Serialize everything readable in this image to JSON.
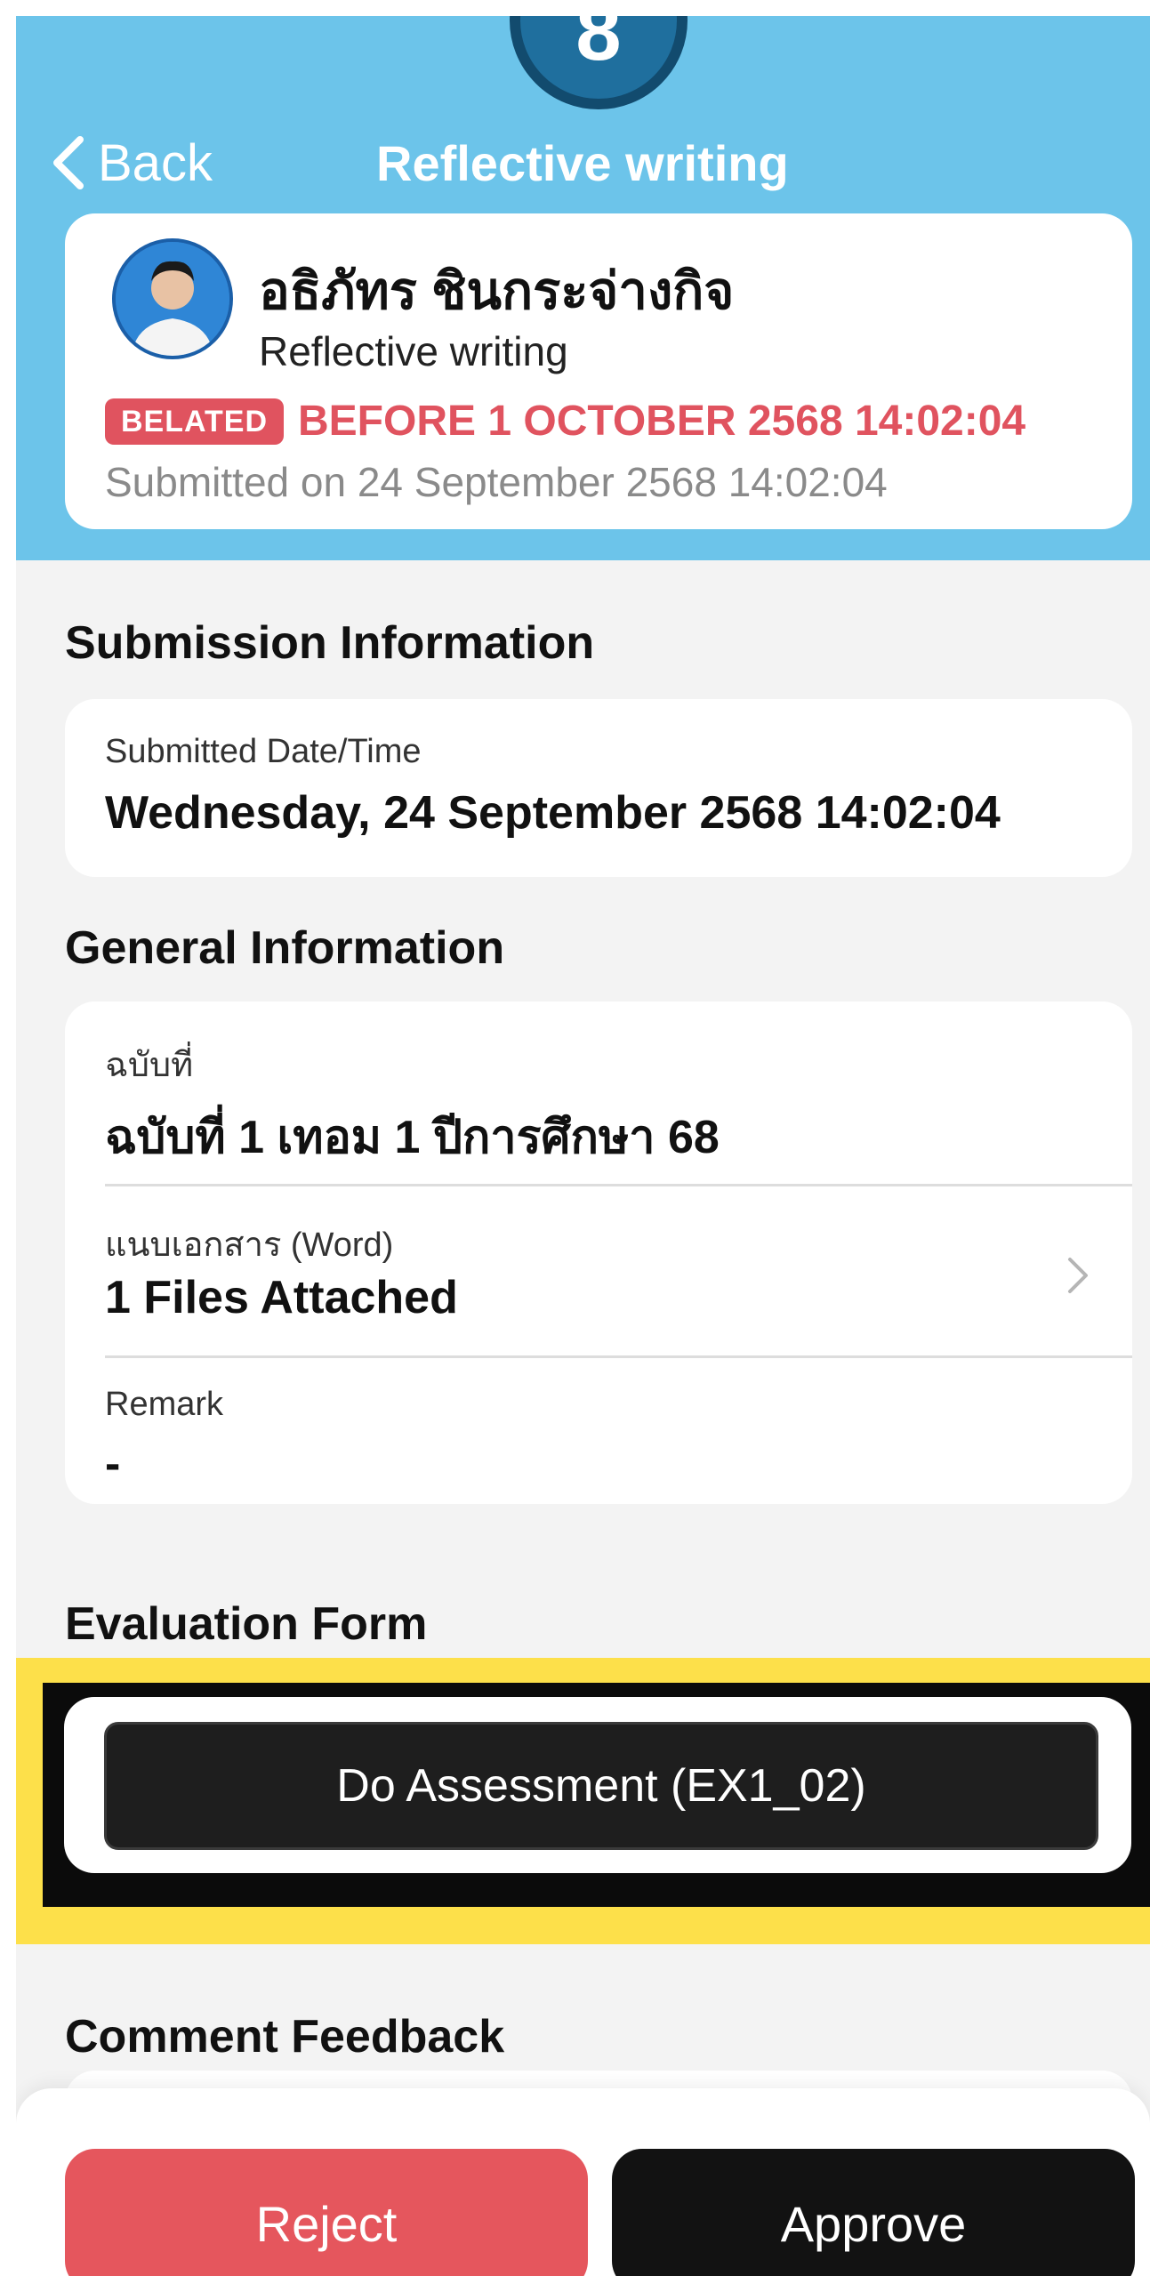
{
  "step": "8",
  "nav": {
    "back_label": "Back",
    "title": "Reflective writing"
  },
  "profile": {
    "name": "อธิภัทร ชินกระจ่างกิจ",
    "assignment": "Reflective writing",
    "status_badge": "BELATED",
    "due": "BEFORE 1 OCTOBER 2568 14:02:04",
    "submitted": "Submitted on 24 September 2568 14:02:04"
  },
  "submission_info": {
    "section_title": "Submission Information",
    "label": "Submitted Date/Time",
    "value": "Wednesday, 24 September 2568 14:02:04"
  },
  "general_info": {
    "section_title": "General Information",
    "fields": [
      {
        "label": "ฉบับที่",
        "value": "ฉบับที่ 1 เทอม 1 ปีการศึกษา 68"
      },
      {
        "label": "แนบเอกสาร (Word)",
        "value": "1 Files Attached"
      },
      {
        "label": "Remark",
        "value": "-"
      }
    ]
  },
  "evaluation": {
    "section_title": "Evaluation Form",
    "button_label": "Do Assessment (EX1_02)"
  },
  "comment": {
    "section_title": "Comment Feedback"
  },
  "actions": {
    "reject_label": "Reject",
    "approve_label": "Approve"
  },
  "colors": {
    "header": "#6cc4ea",
    "belated": "#e0535f",
    "highlight": "#fde04a",
    "reject": "#e5565d",
    "approve": "#121212"
  }
}
